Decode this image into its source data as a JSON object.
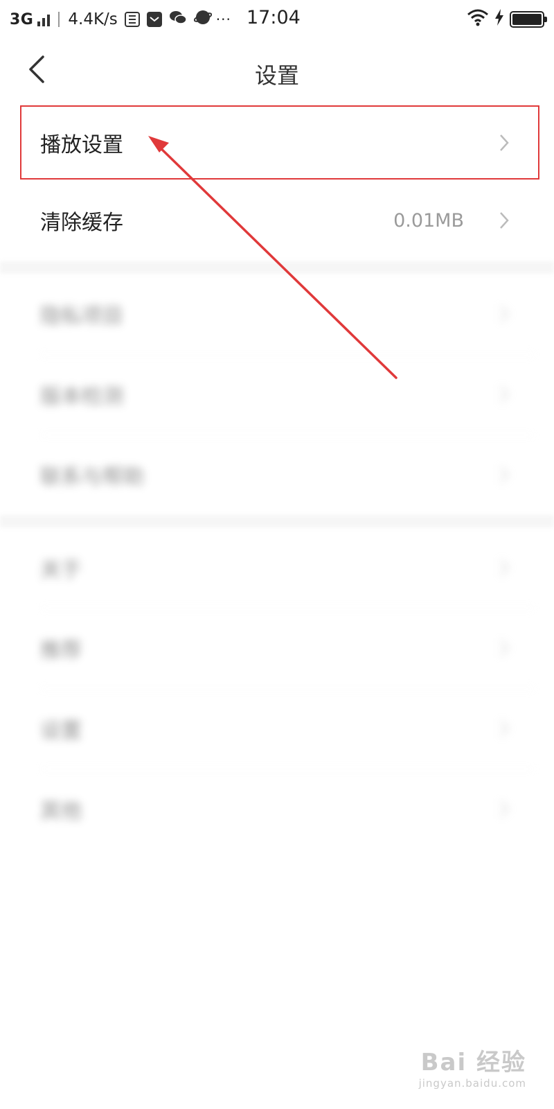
{
  "status_bar": {
    "network": "3G",
    "speed": "4.4K/s",
    "time": "17:04",
    "icons": [
      "signal-icon",
      "message-icon",
      "mail-icon",
      "wechat-icon",
      "browser-icon",
      "more-dots-icon",
      "wifi-icon",
      "charging-icon",
      "battery-icon"
    ],
    "more": "···"
  },
  "header": {
    "title": "设置",
    "back_icon": "back-arrow-icon"
  },
  "settings": [
    {
      "label": "播放设置",
      "value": "",
      "highlighted": true
    },
    {
      "label": "清除缓存",
      "value": "0.01MB",
      "highlighted": false
    }
  ],
  "blurred_rows": [
    "隐私项目",
    "版本检测",
    "联系与帮助",
    "关于",
    "推荐",
    "设置",
    "其他"
  ],
  "annotation": {
    "color": "#e0393a"
  },
  "watermark": {
    "main": "Bai 经验",
    "sub": "jingyan.baidu.com"
  }
}
